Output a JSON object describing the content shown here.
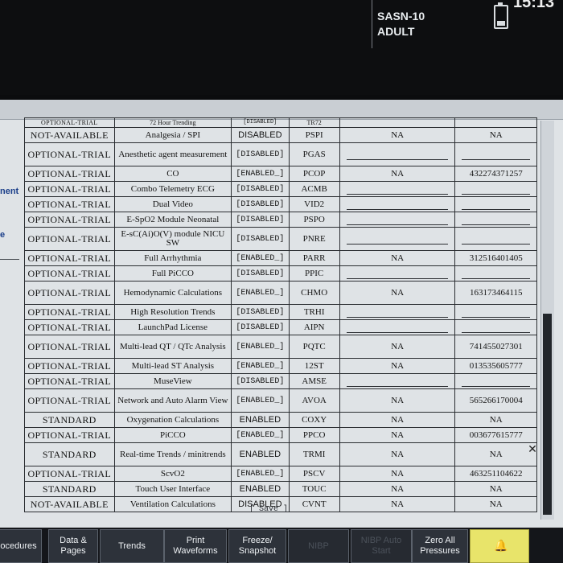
{
  "header": {
    "patient_id": "SASN-10",
    "patient_category": "ADULT",
    "time": "15:13",
    "battery_icon": "battery-icon"
  },
  "sidebar": {
    "labels": [
      "nent",
      "e"
    ]
  },
  "table": {
    "top_partial": {
      "status": "OPTIONAL-TRIAL",
      "feature": "72 Hour Trending",
      "state": "[DISABLED]",
      "code": "TR72"
    },
    "rows": [
      {
        "status": "NOT-AVAILABLE",
        "feature": "Analgesia / SPI",
        "state": "DISABLED",
        "code": "PSPI",
        "na": "NA",
        "key": "NA"
      },
      {
        "status": "OPTIONAL-TRIAL",
        "feature": "Anesthetic agent measurement",
        "state": "[DISABLED]",
        "code": "PGAS",
        "na": "",
        "key": ""
      },
      {
        "status": "OPTIONAL-TRIAL",
        "feature": "CO",
        "state": "[ENABLED_]",
        "code": "PCOP",
        "na": "NA",
        "key": "432274371257"
      },
      {
        "status": "OPTIONAL-TRIAL",
        "feature": "Combo Telemetry ECG",
        "state": "[DISABLED]",
        "code": "ACMB",
        "na": "",
        "key": ""
      },
      {
        "status": "OPTIONAL-TRIAL",
        "feature": "Dual Video",
        "state": "[DISABLED]",
        "code": "VID2",
        "na": "",
        "key": ""
      },
      {
        "status": "OPTIONAL-TRIAL",
        "feature": "E-SpO2 Module Neonatal",
        "state": "[DISABLED]",
        "code": "PSPO",
        "na": "",
        "key": ""
      },
      {
        "status": "OPTIONAL-TRIAL",
        "feature": "E-sC(Ai)O(V) module NICU SW",
        "state": "[DISABLED]",
        "code": "PNRE",
        "na": "",
        "key": ""
      },
      {
        "status": "OPTIONAL-TRIAL",
        "feature": "Full Arrhythmia",
        "state": "[ENABLED_]",
        "code": "PARR",
        "na": "NA",
        "key": "312516401405"
      },
      {
        "status": "OPTIONAL-TRIAL",
        "feature": "Full PiCCO",
        "state": "[DISABLED]",
        "code": "PPIC",
        "na": "",
        "key": ""
      },
      {
        "status": "OPTIONAL-TRIAL",
        "feature": "Hemodynamic Calculations",
        "state": "[ENABLED_]",
        "code": "CHMO",
        "na": "NA",
        "key": "163173464115"
      },
      {
        "status": "OPTIONAL-TRIAL",
        "feature": "High Resolution Trends",
        "state": "[DISABLED]",
        "code": "TRHI",
        "na": "",
        "key": ""
      },
      {
        "status": "OPTIONAL-TRIAL",
        "feature": "LaunchPad License",
        "state": "[DISABLED]",
        "code": "AIPN",
        "na": "",
        "key": ""
      },
      {
        "status": "OPTIONAL-TRIAL",
        "feature": "Multi-lead QT / QTc Analysis",
        "state": "[ENABLED_]",
        "code": "PQTC",
        "na": "NA",
        "key": "741455027301"
      },
      {
        "status": "OPTIONAL-TRIAL",
        "feature": "Multi-lead ST Analysis",
        "state": "[ENABLED_]",
        "code": "12ST",
        "na": "NA",
        "key": "013535605777"
      },
      {
        "status": "OPTIONAL-TRIAL",
        "feature": "MuseView",
        "state": "[DISABLED]",
        "code": "AMSE",
        "na": "",
        "key": ""
      },
      {
        "status": "OPTIONAL-TRIAL",
        "feature": "Network and Auto Alarm View",
        "state": "[ENABLED_]",
        "code": "AVOA",
        "na": "NA",
        "key": "565266170004"
      },
      {
        "status": "STANDARD",
        "feature": "Oxygenation Calculations",
        "state": "ENABLED",
        "code": "COXY",
        "na": "NA",
        "key": "NA"
      },
      {
        "status": "OPTIONAL-TRIAL",
        "feature": "PiCCO",
        "state": "[ENABLED_]",
        "code": "PPCO",
        "na": "NA",
        "key": "003677615777"
      },
      {
        "status": "STANDARD",
        "feature": "Real-time Trends / minitrends",
        "state": "ENABLED",
        "code": "TRMI",
        "na": "NA",
        "key": "NA"
      },
      {
        "status": "OPTIONAL-TRIAL",
        "feature": "ScvO2",
        "state": "[ENABLED_]",
        "code": "PSCV",
        "na": "NA",
        "key": "463251104622"
      },
      {
        "status": "STANDARD",
        "feature": "Touch User Interface",
        "state": "ENABLED",
        "code": "TOUC",
        "na": "NA",
        "key": "NA"
      },
      {
        "status": "NOT-AVAILABLE",
        "feature": "Ventilation Calculations",
        "state": "DISABLED",
        "code": "CVNT",
        "na": "NA",
        "key": "NA"
      }
    ]
  },
  "save_label": "[ Save ]",
  "close_icon": "close-icon",
  "bottom_buttons": [
    {
      "label": "ocedures",
      "enabled": true
    },
    {
      "label": "Data &\nPages",
      "enabled": true
    },
    {
      "label": "Trends",
      "enabled": true
    },
    {
      "label": "Print\nWaveforms",
      "enabled": true
    },
    {
      "label": "Freeze/\nSnapshot",
      "enabled": true
    },
    {
      "label": "NIBP",
      "enabled": false
    },
    {
      "label": "NIBP Auto\nStart",
      "enabled": false
    },
    {
      "label": "Zero All\nPressures",
      "enabled": true
    }
  ],
  "alarm_icon": "bell-icon"
}
